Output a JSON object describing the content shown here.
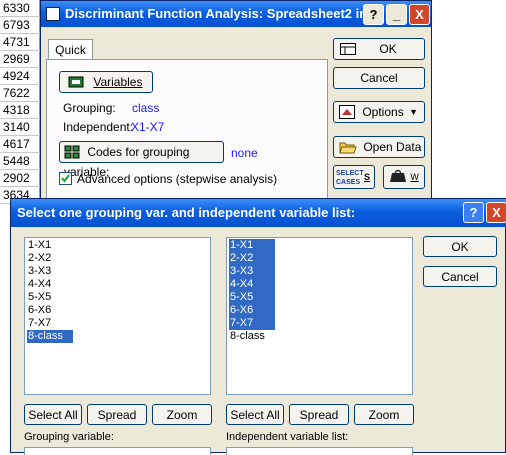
{
  "sheet": {
    "values": [
      "6330",
      "6793",
      "4731",
      "2969",
      "4924",
      "7622",
      "4318",
      "3140",
      "4617",
      "5448",
      "2902",
      "3634"
    ]
  },
  "back_dialog": {
    "title": "Discriminant Function Analysis: Spreadsheet2 in",
    "help_btn": "?",
    "min_btn": "_",
    "close_btn": "X",
    "tab_quick": "Quick",
    "variables_btn": "Variables",
    "grouping_label": "Grouping:",
    "grouping_value": "class",
    "independent_label": "Independent:",
    "independent_value": "X1-X7",
    "codes_btn": "Codes for grouping variable:",
    "codes_value": "none",
    "advanced_label": "Advanced options (stepwise analysis)",
    "advanced_checked": true,
    "ok_btn": "OK",
    "cancel_btn": "Cancel",
    "options_btn": "Options",
    "open_data_btn": "Open Data",
    "select_cases_label1": "SELECT",
    "select_cases_label2": "CASES",
    "s_label": "S",
    "w_label": "W"
  },
  "front_dialog": {
    "title": "Select one grouping var. and independent variable list:",
    "help_btn": "?",
    "close_btn": "X",
    "ok_btn": "OK",
    "cancel_btn": "Cancel",
    "left_list": [
      "1-X1",
      "2-X2",
      "3-X3",
      "4-X4",
      "5-X5",
      "6-X6",
      "7-X7",
      "8-class"
    ],
    "right_list": [
      "1-X1",
      "2-X2",
      "3-X3",
      "4-X4",
      "5-X5",
      "6-X6",
      "7-X7",
      "8-class"
    ],
    "select_all_btn": "Select All",
    "spread_btn": "Spread",
    "zoom_btn": "Zoom",
    "grouping_variable_label": "Grouping variable:",
    "independent_list_label": "Independent variable list:"
  },
  "colors": {
    "title_blue": "#0a5fe0",
    "selection": "#316ac5",
    "dialog_bg": "#ece9d8"
  }
}
